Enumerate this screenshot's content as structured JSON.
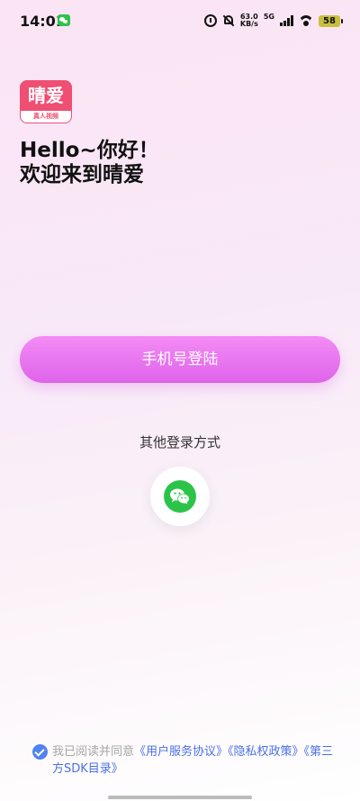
{
  "status_bar": {
    "time": "14:01",
    "speed_value": "63.0",
    "speed_unit": "KB/s",
    "network": "5G",
    "battery": "58"
  },
  "logo": {
    "title": "晴爱",
    "subtitle": "真人视频"
  },
  "greeting": "Hello~你好！",
  "welcome": "欢迎来到晴爱",
  "buttons": {
    "phone_login": "手机号登陆"
  },
  "other_login": {
    "label": "其他登录方式",
    "wechat_icon": "wechat-icon"
  },
  "agreement": {
    "checked": true,
    "prefix": "我已阅读并同意",
    "user_agreement": "《用户服务协议》",
    "privacy_policy": "《隐私权政策》",
    "sdk_list": "《第三方SDK目录》"
  },
  "colors": {
    "primary": "#e56ff0",
    "wechat": "#2cc448",
    "link": "#4a70e6",
    "logo": "#ee4f72"
  }
}
